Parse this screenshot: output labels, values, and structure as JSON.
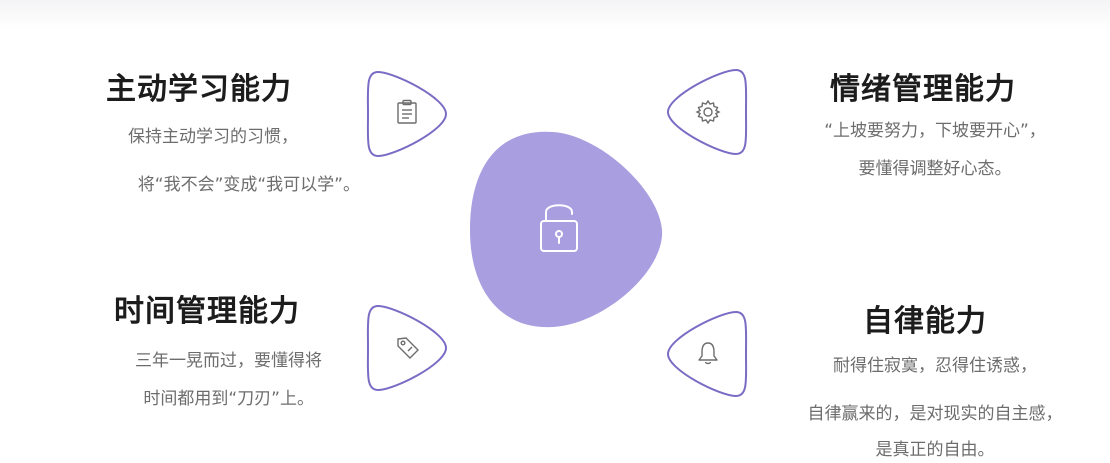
{
  "accent_color": "#a99ee0",
  "outline_color": "#7c6bc4",
  "center_icon": "padlock-open-icon",
  "items": [
    {
      "title": "主动学习能力",
      "lines": [
        "保持主动学习的习惯，",
        "将“我不会”变成“我可以学”。"
      ],
      "icon": "clipboard-icon"
    },
    {
      "title": "情绪管理能力",
      "lines": [
        "“上坡要努力，下坡要开心”，",
        "要懂得调整好心态。"
      ],
      "icon": "gear-icon"
    },
    {
      "title": "时间管理能力",
      "lines": [
        "三年一晃而过，要懂得将",
        "时间都用到“刀刃”上。"
      ],
      "icon": "price-tag-icon"
    },
    {
      "title": "自律能力",
      "lines": [
        "耐得住寂寞，忍得住诱惑，",
        "自律赢来的，是对现实的自主感，",
        "是真正的自由。"
      ],
      "icon": "bell-icon"
    }
  ]
}
